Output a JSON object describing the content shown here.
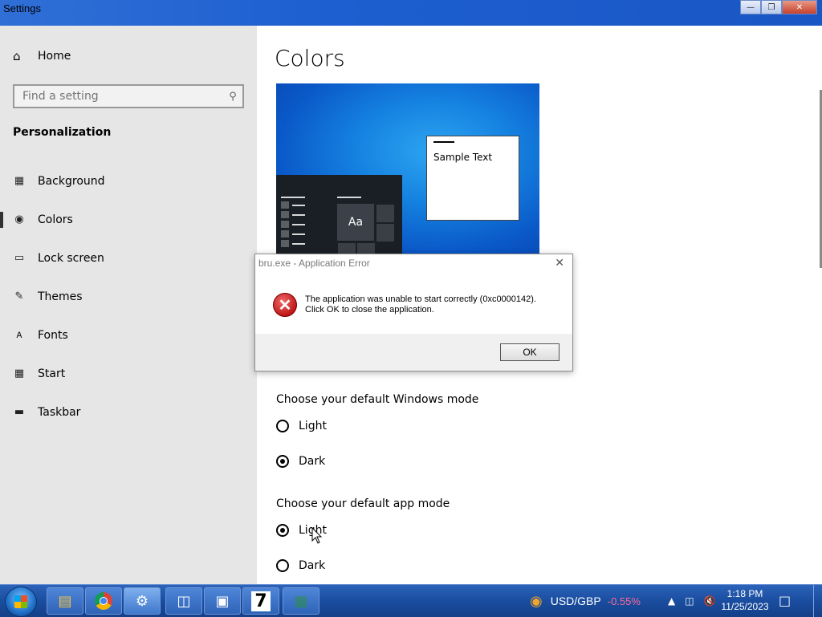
{
  "window": {
    "title": "Settings"
  },
  "sidebar": {
    "home_label": "Home",
    "search_placeholder": "Find a setting",
    "section_title": "Personalization",
    "items": [
      {
        "label": "Background",
        "icon": "picture-icon"
      },
      {
        "label": "Colors",
        "icon": "palette-icon",
        "active": true
      },
      {
        "label": "Lock screen",
        "icon": "lock-screen-icon"
      },
      {
        "label": "Themes",
        "icon": "themes-icon"
      },
      {
        "label": "Fonts",
        "icon": "fonts-icon"
      },
      {
        "label": "Start",
        "icon": "start-icon"
      },
      {
        "label": "Taskbar",
        "icon": "taskbar-icon"
      }
    ]
  },
  "main": {
    "title": "Colors",
    "preview": {
      "sample_text": "Sample Text",
      "tile_text": "Aa"
    },
    "windows_mode": {
      "label": "Choose your default Windows mode",
      "options": [
        {
          "label": "Light",
          "selected": false
        },
        {
          "label": "Dark",
          "selected": true
        }
      ]
    },
    "app_mode": {
      "label": "Choose your default app mode",
      "options": [
        {
          "label": "Light",
          "selected": true
        },
        {
          "label": "Dark",
          "selected": false
        }
      ]
    }
  },
  "dialog": {
    "title": "bru.exe - Application Error",
    "message_line1": "The application was unable to start correctly (0xc0000142).",
    "message_line2": "Click OK to close the application.",
    "ok_label": "OK"
  },
  "taskbar": {
    "apps": [
      "file-explorer-icon",
      "chrome-icon",
      "settings-icon",
      "network-app-icon",
      "installer-icon",
      "7zip-icon",
      "excel-icon"
    ],
    "seven_zip_label": "7",
    "currency_pair": "USD/GBP",
    "currency_change": "-0.55%",
    "time": "1:18 PM",
    "date": "11/25/2023"
  },
  "colors": {
    "titlebar": "#1d5fd0",
    "sidebar_bg": "#e6e6e6",
    "error_red": "#c01818",
    "change_negative": "#ff6a9a"
  }
}
